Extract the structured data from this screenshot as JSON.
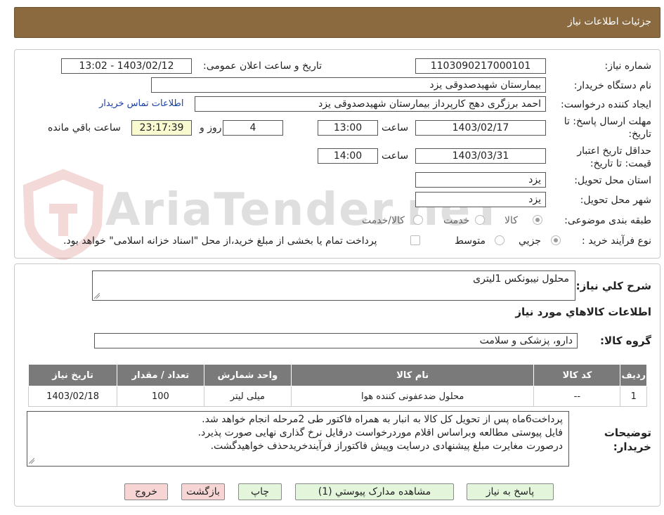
{
  "header": {
    "title": "جزئیات اطلاعات نیاز"
  },
  "form": {
    "need_number_label": "شماره نیاز:",
    "need_number": "1103090217000101",
    "announce_label": "تاریخ و ساعت اعلان عمومی:",
    "announce_value": "1403/02/12 - 13:02",
    "buyer_org_label": "نام دستگاه خریدار:",
    "buyer_org": "بیمارستان شهیدصدوقی یزد",
    "requester_label": "ایجاد کننده درخواست:",
    "requester": "احمد برزگری دهج کارپرداز بیمارستان شهیدصدوقی یزد",
    "contact_link": "اطلاعات تماس خریدار",
    "deadline_label": "مهلت ارسال پاسخ: تا تاریخ:",
    "deadline_date": "1403/02/17",
    "time_label": "ساعت",
    "deadline_time": "13:00",
    "days_value": "4",
    "days_label": "روز و",
    "remaining_time": "23:17:39",
    "remaining_label": "ساعت باقي مانده",
    "validity_label": "حداقل تاریخ اعتبار قیمت: تا تاریخ:",
    "validity_date": "1403/03/31",
    "validity_time": "14:00",
    "province_label": "استان محل تحویل:",
    "province": "یزد",
    "city_label": "شهر محل تحویل:",
    "city": "یزد",
    "category_label": "طبقه بندی موضوعی:",
    "category_options": [
      "کالا",
      "خدمت",
      "کالا/خدمت"
    ],
    "purchase_type_label": "نوع فرآیند خرید :",
    "purchase_options": [
      "جزیي",
      "متوسط"
    ],
    "payment_note": "پرداخت تمام یا بخشی از مبلغ خرید،از محل \"اسناد خزانه اسلامی\" خواهد بود."
  },
  "details": {
    "general_desc_label": "شرح کلي نیاز:",
    "general_desc": "محلول نیبونکس 1لیتری",
    "goods_info_title": "اطلاعات کالاهاي مورد نیاز",
    "goods_group_label": "گروه کالا:",
    "goods_group": "دارو، پزشکی و سلامت"
  },
  "table": {
    "headers": [
      "ردیف",
      "کد کالا",
      "نام کالا",
      "واحد شمارش",
      "تعداد / مقدار",
      "تاریخ نیاز"
    ],
    "rows": [
      [
        "1",
        "--",
        "محلول ضدعفونی کننده هوا",
        "میلی لیتر",
        "100",
        "1403/02/18"
      ]
    ]
  },
  "notes": {
    "label": "توضیحات خریدار:",
    "lines": [
      "پرداخت6ماه پس از تحویل کل کالا به انبار به همراه فاکتور طی 2مرحله انجام خواهد شد.",
      "فایل پیوستی مطالعه وبراساس اقلام موردرخواست درفایل نرخ گذاری نهایی  صورت پذیرد.",
      "درصورت مغایرت مبلغ پیشنهادی درسایت وپیش فاکتوراز فرآیندخریدحذف خواهیدگشت."
    ]
  },
  "buttons": {
    "reply": "پاسخ به نیاز",
    "attachments": "مشاهده مدارک پیوستي (1)",
    "print": "چاپ",
    "back": "بازگشت",
    "exit": "خروج"
  },
  "watermark": {
    "text": "AriaTender.neT"
  },
  "colors": {
    "header_bg": "#8b6a3f",
    "table_header_bg": "#7a7a7a",
    "green_button": "#e3f6dc",
    "pink_button": "#f7d5d5",
    "link": "#1a3fa6"
  }
}
